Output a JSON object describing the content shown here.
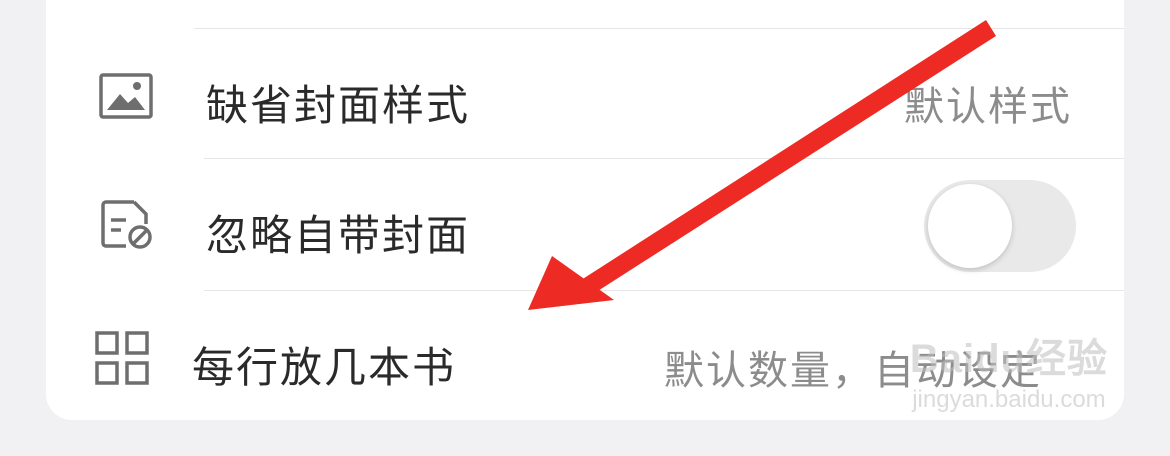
{
  "settings": {
    "rows": [
      {
        "label": "缺省封面样式",
        "value": "默认样式",
        "icon": "image-icon"
      },
      {
        "label": "忽略自带封面",
        "value": "",
        "icon": "ignore-cover-icon",
        "toggle_on": false
      },
      {
        "label": "每行放几本书",
        "value": "默认数量，自动设定",
        "icon": "grid-icon"
      }
    ]
  },
  "annotation": {
    "arrow_color": "#ee2a24"
  },
  "watermark": {
    "brand": "Baidu经验",
    "site": "jingyan.baidu.com"
  }
}
